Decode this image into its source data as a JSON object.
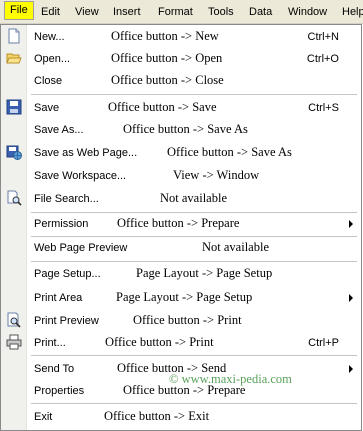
{
  "menubar": {
    "items": [
      "File",
      "Edit",
      "View",
      "Insert",
      "Format",
      "Tools",
      "Data",
      "Window",
      "Help"
    ]
  },
  "menu": {
    "items": [
      {
        "label": "New...",
        "mapping": "Office button -> New",
        "shortcut": "Ctrl+N",
        "icon": "new-document-icon"
      },
      {
        "label": "Open...",
        "mapping": "Office button -> Open",
        "shortcut": "Ctrl+O",
        "icon": "open-folder-icon"
      },
      {
        "label": "Close",
        "mapping": "Office button -> Close"
      },
      {
        "label": "Save",
        "mapping": "Office button -> Save",
        "shortcut": "Ctrl+S",
        "icon": "floppy-disk-icon"
      },
      {
        "label": "Save As...",
        "mapping": "Office button -> Save As"
      },
      {
        "label": "Save as Web Page...",
        "mapping": "Office button -> Save As",
        "icon": "web-page-save-icon"
      },
      {
        "label": "Save Workspace...",
        "mapping": "View -> Window"
      },
      {
        "label": "File Search...",
        "mapping": "Not available",
        "icon": "file-search-icon"
      },
      {
        "label": "Permission",
        "mapping": "Office button -> Prepare",
        "submenu": true
      },
      {
        "label": "Web Page Preview",
        "mapping": "Not available"
      },
      {
        "label": "Page Setup...",
        "mapping": "Page Layout -> Page Setup"
      },
      {
        "label": "Print Area",
        "mapping": "Page Layout -> Page Setup",
        "submenu": true
      },
      {
        "label": "Print Preview",
        "mapping": "Office button -> Print",
        "icon": "print-preview-icon"
      },
      {
        "label": "Print...",
        "mapping": "Office button -> Print",
        "shortcut": "Ctrl+P",
        "icon": "printer-icon"
      },
      {
        "label": "Send To",
        "mapping": "Office button -> Send",
        "submenu": true
      },
      {
        "label": "Properties",
        "mapping": "Office button -> Prepare"
      },
      {
        "label": "Exit",
        "mapping": "Office button -> Exit"
      }
    ]
  },
  "watermark": "© www.maxi-pedia.com",
  "colors": {
    "active_menu_bg": "#ffff00",
    "watermark": "#5aa05a",
    "menubar_bg": "#ece9d8"
  }
}
